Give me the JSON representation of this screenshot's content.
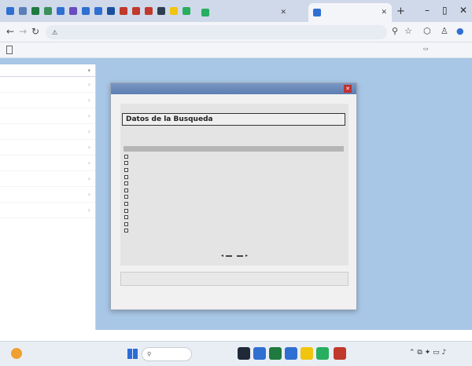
{
  "browser": {
    "tabs": [
      {
        "label": "",
        "active": false
      },
      {
        "label": "",
        "active": true
      }
    ],
    "new_tab_symbol": "+",
    "window_controls": [
      "–",
      "▯",
      "✕"
    ],
    "address": {
      "site_tag": "",
      "url": "",
      "nav_symbols": [
        "←",
        "→",
        "↻"
      ]
    },
    "bookmark_right_label": ""
  },
  "sidebar": {
    "header": "",
    "items": [
      {
        "label": ""
      },
      {
        "label": ""
      },
      {
        "label": ""
      },
      {
        "label": ""
      },
      {
        "label": ""
      },
      {
        "label": ""
      },
      {
        "label": ""
      },
      {
        "label": ""
      },
      {
        "label": ""
      }
    ]
  },
  "page": {
    "title": ""
  },
  "modal": {
    "title": "",
    "panel_title": "Datos de la Busqueda",
    "subtitle": "",
    "results": [
      {
        "label": "",
        "checked": false
      },
      {
        "label": "",
        "checked": false
      },
      {
        "label": "",
        "checked": false
      },
      {
        "label": "",
        "checked": false
      },
      {
        "label": "",
        "checked": false
      },
      {
        "label": "",
        "checked": false
      },
      {
        "label": "",
        "checked": false
      },
      {
        "label": "",
        "checked": false
      },
      {
        "label": "",
        "checked": false
      },
      {
        "label": "",
        "checked": false
      },
      {
        "label": "",
        "checked": false
      },
      {
        "label": "",
        "checked": false
      }
    ],
    "pager": {
      "prev_symbol": "◂",
      "prev_label": "",
      "page_text": "",
      "next_label": "",
      "next_symbol": "▸"
    },
    "result_box_text": ""
  },
  "footer": {
    "text": ""
  },
  "taskbar": {
    "weather_temp": "",
    "weather_desc": "",
    "search_placeholder": "",
    "clock_time": "",
    "clock_date": ""
  },
  "colors": {
    "page_bg": "#a8c6e6",
    "modal_title_bar": "#5c7db1",
    "close_button": "#c03030",
    "sidebar_link": "#3c6bb0"
  }
}
